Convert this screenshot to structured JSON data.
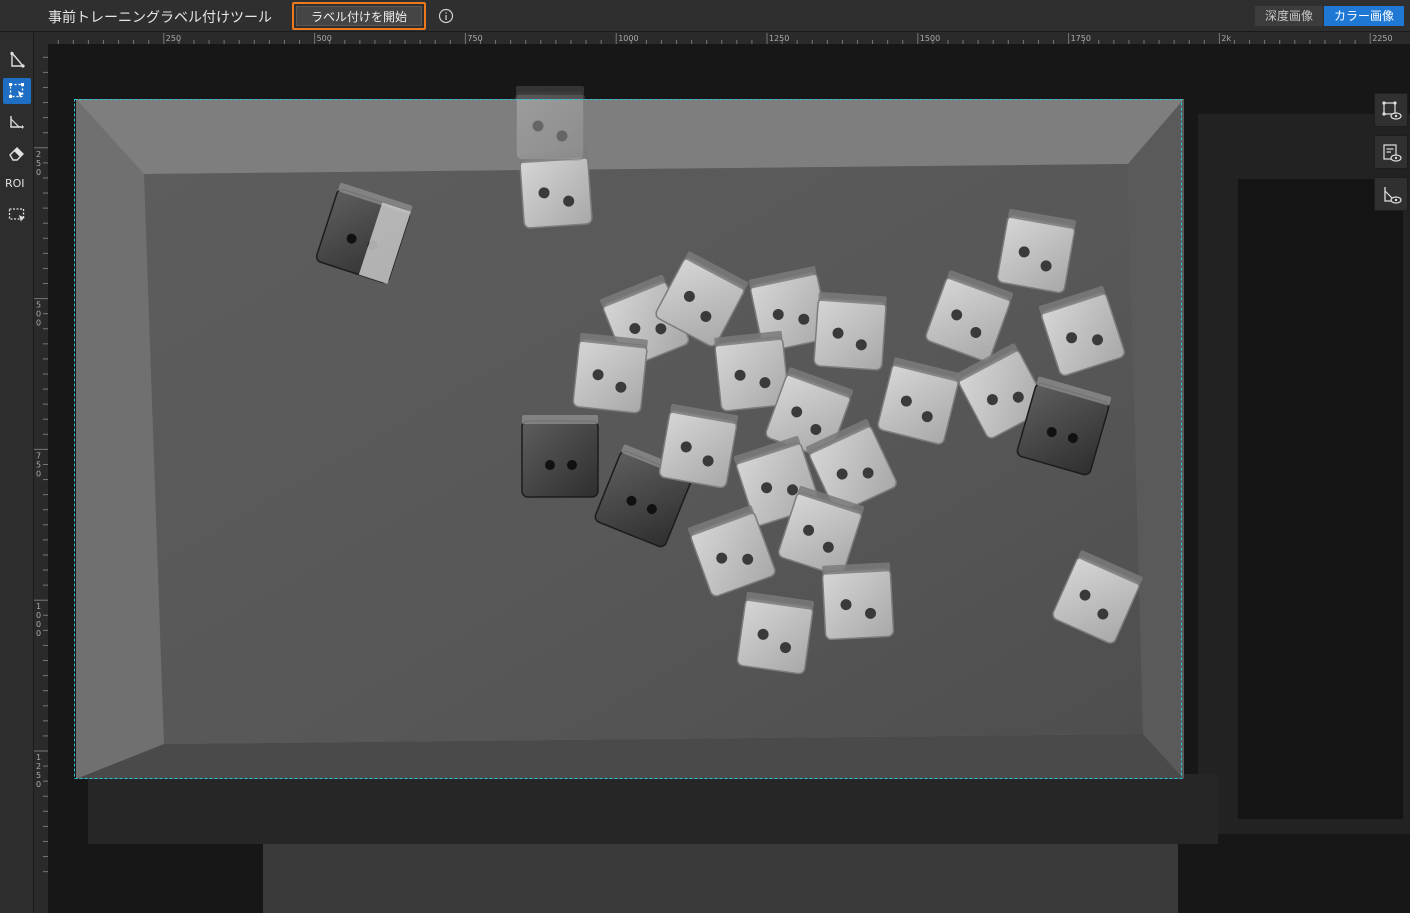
{
  "app": {
    "title": "事前トレーニングラベル付けツール",
    "start_label": "ラベル付けを開始"
  },
  "image_tabs": {
    "depth": "深度画像",
    "color": "カラー画像",
    "selected": "color"
  },
  "colors": {
    "accent": "#1e78d4",
    "highlight_border": "#ec7a1c",
    "roi_outline": "#22c9d8"
  },
  "left_tools": [
    {
      "name": "polygon-tool",
      "icon": "polygon-tool-icon",
      "active": false
    },
    {
      "name": "rectangle-select-tool",
      "icon": "rectangle-select-icon",
      "active": true
    },
    {
      "name": "corner-tool",
      "icon": "corner-tool-icon",
      "active": false
    },
    {
      "name": "eraser-tool",
      "icon": "eraser-icon",
      "active": false
    },
    {
      "name": "roi-tool",
      "label": "ROI",
      "active": false
    },
    {
      "name": "screen-capture-tool",
      "icon": "screen-capture-icon",
      "active": false
    }
  ],
  "right_tools": [
    {
      "name": "show-polygon-toggle",
      "icon": "polygon-eye-icon"
    },
    {
      "name": "show-label-toggle",
      "icon": "label-eye-icon"
    },
    {
      "name": "show-mask-toggle",
      "icon": "mask-eye-icon"
    }
  ],
  "ruler_h": {
    "labels": [
      {
        "value": 250,
        "text": "250"
      },
      {
        "value": 500,
        "text": "500"
      },
      {
        "value": 750,
        "text": "750"
      },
      {
        "value": 1000,
        "text": "1000"
      },
      {
        "value": 1250,
        "text": "1250"
      },
      {
        "value": 1500,
        "text": "1500"
      },
      {
        "value": 1750,
        "text": "1750"
      },
      {
        "value": 2000,
        "text": "2k"
      },
      {
        "value": 2250,
        "text": "2250"
      }
    ]
  },
  "ruler_v": {
    "labels": [
      {
        "value": 250,
        "text": "250"
      },
      {
        "value": 500,
        "text": "500"
      },
      {
        "value": 750,
        "text": "750"
      },
      {
        "value": 1000,
        "text": "1000"
      },
      {
        "value": 1250,
        "text": "1250"
      }
    ]
  }
}
